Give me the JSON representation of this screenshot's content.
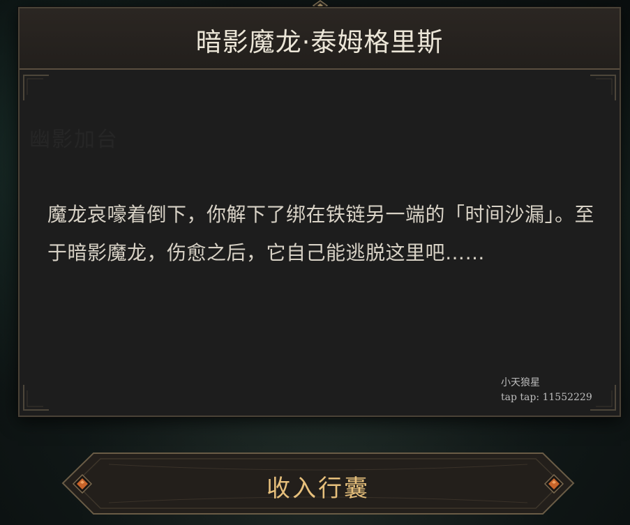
{
  "dialog": {
    "title": "暗影魔龙·泰姆格里斯",
    "faded_heading": "幽影加台",
    "description": "魔龙哀嚎着倒下，你解下了绑在铁链另一端的「时间沙漏」。至于暗影魔龙，伤愈之后，它自己能逃脱这里吧……"
  },
  "watermark": {
    "line1": "小天狼星",
    "line2": "tap tap: 11552229"
  },
  "action": {
    "label": "收入行囊"
  },
  "colors": {
    "panel_bg": "#1d1d1d",
    "header_bg": "#2b2622",
    "border": "#4a4337",
    "title_text": "#ece6d8",
    "body_text": "#d8d2c6",
    "button_text": "#e7c07c",
    "gem": "#c8642a"
  },
  "icons": [
    "diamond-ornament-icon",
    "corner-flourish-icon",
    "orange-gem-icon"
  ]
}
